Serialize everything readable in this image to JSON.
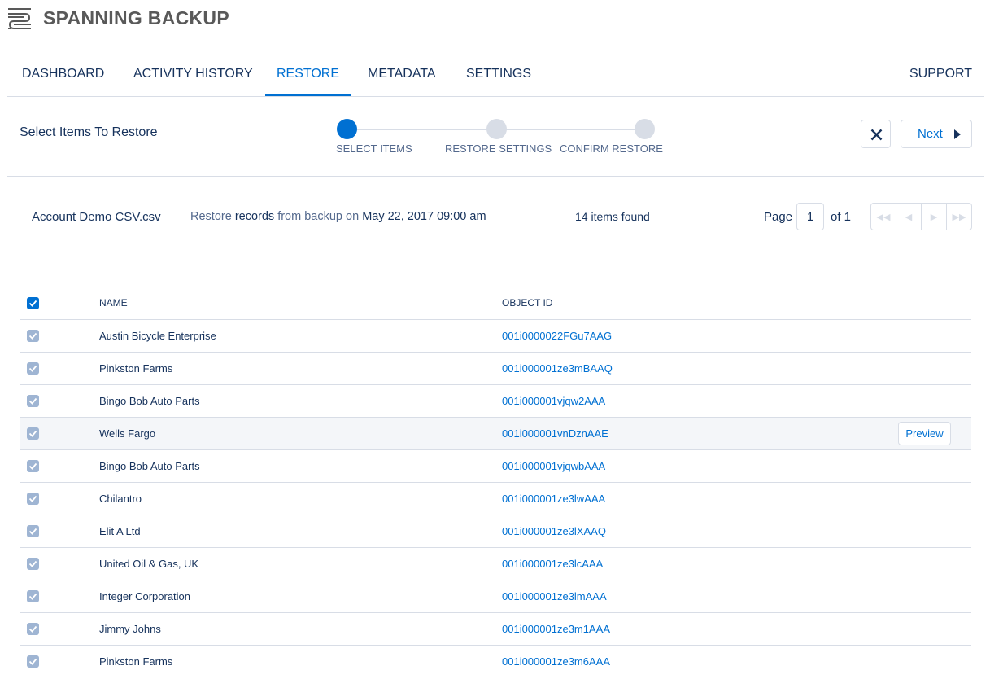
{
  "app": {
    "title": "SPANNING BACKUP",
    "logo_icon": "stacked-lines-logo-icon"
  },
  "nav": {
    "tabs": [
      {
        "label": "DASHBOARD",
        "active": false
      },
      {
        "label": "ACTIVITY HISTORY",
        "active": false
      },
      {
        "label": "RESTORE",
        "active": true
      },
      {
        "label": "METADATA",
        "active": false
      },
      {
        "label": "SETTINGS",
        "active": false
      }
    ],
    "support": "SUPPORT"
  },
  "wizard": {
    "title": "Select Items To Restore",
    "steps": [
      {
        "label": "SELECT ITEMS",
        "active": true
      },
      {
        "label": "RESTORE SETTINGS",
        "active": false
      },
      {
        "label": "CONFIRM RESTORE",
        "active": false
      }
    ],
    "close_icon": "close-x-icon",
    "next_label": "Next"
  },
  "info": {
    "file": "Account Demo CSV.csv",
    "restore_prefix": "Restore",
    "restore_type": "records",
    "restore_middle": "from backup on",
    "restore_date": "May 22, 2017 09:00 am",
    "count": "14 items found",
    "page_label": "Page",
    "page_value": "1",
    "page_of": "of 1"
  },
  "table": {
    "columns": {
      "name": "NAME",
      "object_id": "OBJECT ID"
    },
    "preview_label": "Preview",
    "rows": [
      {
        "name": "Austin Bicycle Enterprise",
        "id": "001i0000022FGu7AAG",
        "checked": true
      },
      {
        "name": "Pinkston Farms",
        "id": "001i000001ze3mBAAQ",
        "checked": true
      },
      {
        "name": "Bingo Bob Auto Parts",
        "id": "001i000001vjqw2AAA",
        "checked": true
      },
      {
        "name": "Wells Fargo",
        "id": "001i000001vnDznAAE",
        "checked": true,
        "hover": true
      },
      {
        "name": "Bingo Bob Auto Parts",
        "id": "001i000001vjqwbAAA",
        "checked": true
      },
      {
        "name": "Chilantro",
        "id": "001i000001ze3lwAAA",
        "checked": true
      },
      {
        "name": "Elit A Ltd",
        "id": "001i000001ze3lXAAQ",
        "checked": true
      },
      {
        "name": "United Oil & Gas, UK",
        "id": "001i000001ze3lcAAA",
        "checked": true
      },
      {
        "name": "Integer Corporation",
        "id": "001i000001ze3lmAAA",
        "checked": true
      },
      {
        "name": "Jimmy Johns",
        "id": "001i000001ze3m1AAA",
        "checked": true
      },
      {
        "name": "Pinkston Farms",
        "id": "001i000001ze3m6AAA",
        "checked": true
      }
    ]
  },
  "colors": {
    "accent": "#0070d2",
    "text": "#16325c",
    "border": "#d8dde6",
    "checkbox": "#9fb5d3"
  }
}
